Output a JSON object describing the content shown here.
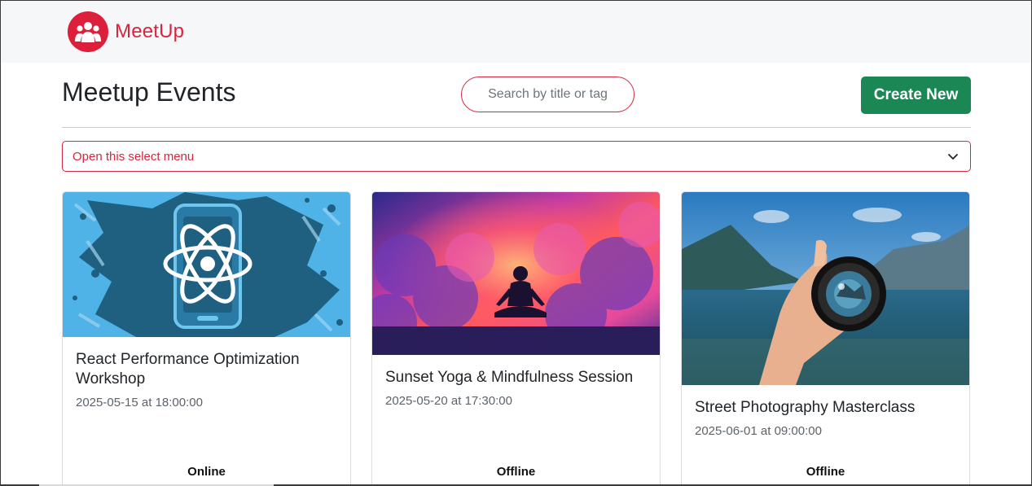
{
  "brand": {
    "name": "MeetUp",
    "logo_icon": "users-group-icon",
    "color": "#dc1f3a"
  },
  "header": {
    "title": "Meetup Events"
  },
  "search": {
    "placeholder": "Search by title or tag",
    "value": ""
  },
  "toolbar": {
    "create_label": "Create New",
    "create_color": "#1a8754"
  },
  "filter": {
    "selected": "Open this select menu",
    "icon": "chevron-down-icon"
  },
  "events": [
    {
      "title": "React Performance Optimization Workshop",
      "date": "2025-05-15 at 18:00:00",
      "mode": "Online",
      "image": "react-logo-phone-image"
    },
    {
      "title": "Sunset Yoga & Mindfulness Session",
      "date": "2025-05-20 at 17:30:00",
      "mode": "Offline",
      "image": "meditation-sunset-image"
    },
    {
      "title": "Street Photography Masterclass",
      "date": "2025-06-01 at 09:00:00",
      "mode": "Offline",
      "image": "camera-lens-lake-image"
    }
  ],
  "colors": {
    "accent": "#d7263d",
    "success": "#1a8754"
  }
}
